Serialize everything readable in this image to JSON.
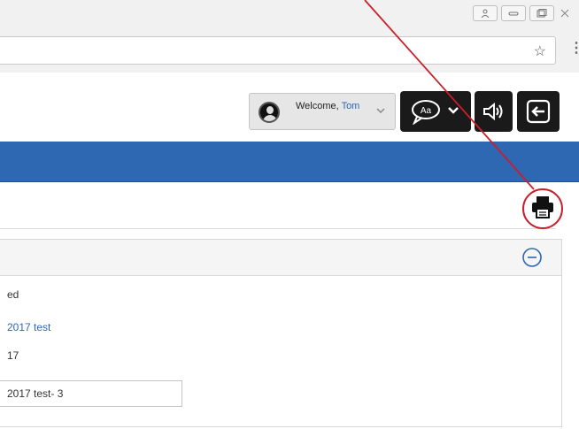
{
  "browser": {
    "window_controls": [
      "person-icon",
      "minimize-icon",
      "restore-icon",
      "close-icon"
    ],
    "bookmark_icon": "star-icon",
    "menu_icon": "kebab-menu-icon"
  },
  "header": {
    "welcome_label": "Welcome,",
    "user_name": "Tom",
    "language_icon": "translate-bubble-icon",
    "audio_icon": "speaker-icon",
    "logout_icon": "logout-icon"
  },
  "toolbar": {
    "print_icon": "printer-icon"
  },
  "panel": {
    "collapse_icon": "collapse-minus-circle-icon",
    "fields": {
      "status_fragment": "ed",
      "link_fragment": "2017 test",
      "date_fragment": "17",
      "input_value": "2017 test- 3"
    }
  },
  "colors": {
    "nav_band": "#2e67b2",
    "link": "#2f66b3",
    "annotation": "#c8202b",
    "dark_button": "#1a1a1a"
  }
}
